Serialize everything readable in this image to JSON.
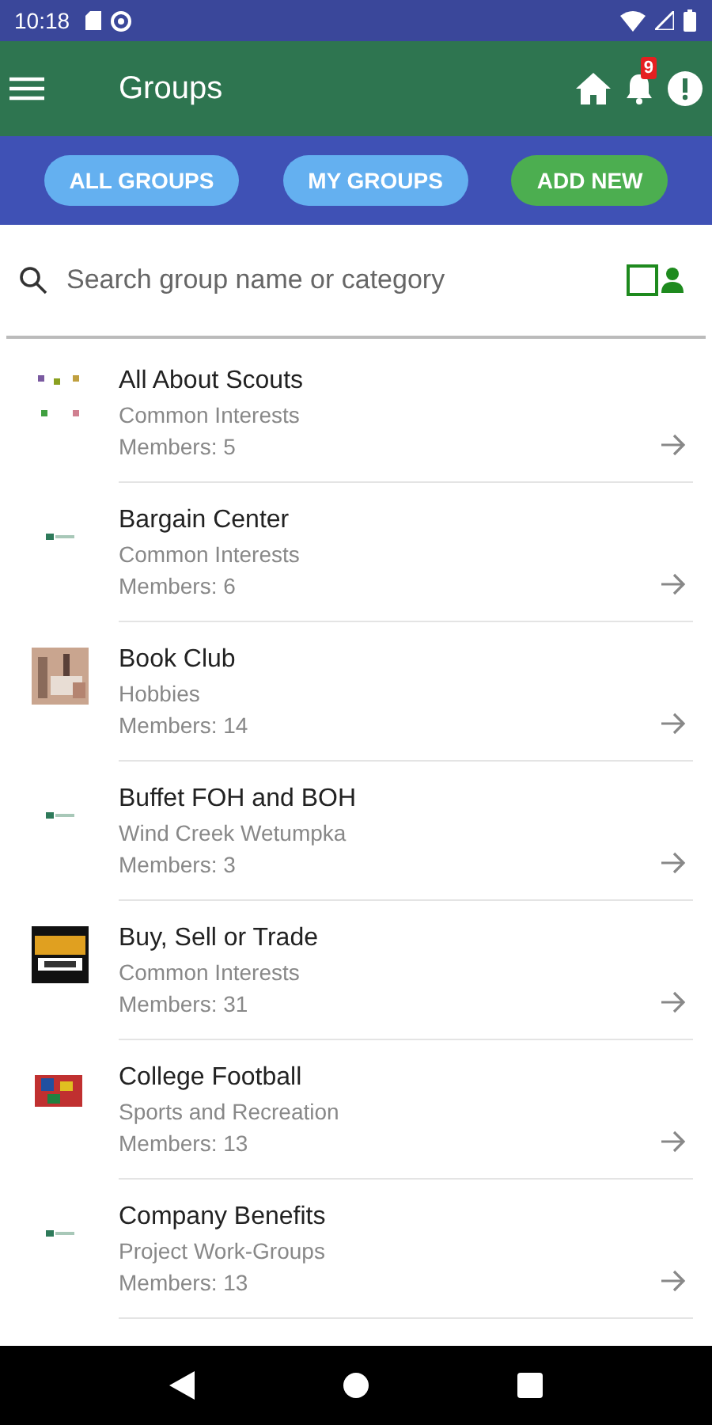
{
  "status_bar": {
    "time": "10:18"
  },
  "app_bar": {
    "title": "Groups",
    "notification_count": "9"
  },
  "filter_buttons": [
    {
      "label": "ALL GROUPS",
      "kind": "filter"
    },
    {
      "label": "MY GROUPS",
      "kind": "filter"
    },
    {
      "label": "ADD NEW",
      "kind": "add"
    }
  ],
  "search": {
    "placeholder": "Search group name or category"
  },
  "groups": [
    {
      "name": "All About Scouts",
      "category": "Common Interests",
      "members": "Members: 5"
    },
    {
      "name": "Bargain Center",
      "category": "Common Interests",
      "members": "Members: 6"
    },
    {
      "name": "Book Club",
      "category": "Hobbies",
      "members": "Members: 14"
    },
    {
      "name": "Buffet FOH and BOH",
      "category": "Wind Creek Wetumpka",
      "members": "Members: 3"
    },
    {
      "name": "Buy, Sell or Trade",
      "category": "Common Interests",
      "members": "Members: 31"
    },
    {
      "name": "College Football",
      "category": "Sports and Recreation",
      "members": "Members: 13"
    },
    {
      "name": "Company Benefits",
      "category": "Project Work-Groups",
      "members": "Members: 13"
    }
  ]
}
